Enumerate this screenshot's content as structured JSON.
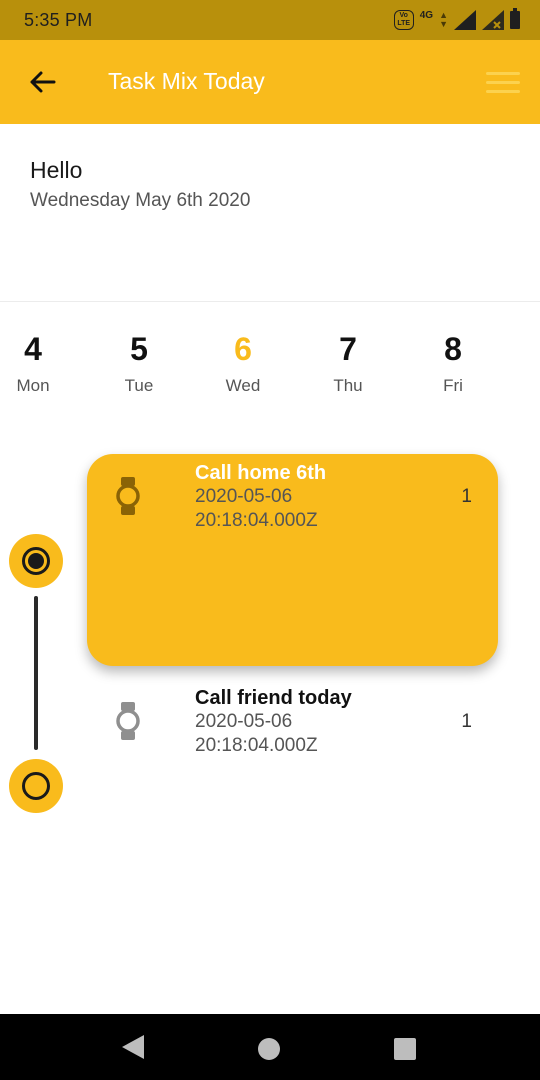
{
  "status_bar": {
    "time": "5:35 PM",
    "volte_label": "VoLTE",
    "network_label": "4G",
    "icons": [
      "volte-icon",
      "signal-icon",
      "signal-icon",
      "battery-icon"
    ]
  },
  "app_bar": {
    "title": "Task Mix Today",
    "back_icon": "arrow-left-icon",
    "menu_icon": "hamburger-menu-icon"
  },
  "greeting": {
    "hello": "Hello",
    "date": "Wednesday May 6th 2020"
  },
  "days": [
    {
      "num": "4",
      "name": "Mon",
      "active": false
    },
    {
      "num": "5",
      "name": "Tue",
      "active": false
    },
    {
      "num": "6",
      "name": "Wed",
      "active": true
    },
    {
      "num": "7",
      "name": "Thu",
      "active": false
    },
    {
      "num": "8",
      "name": "Fri",
      "active": false
    }
  ],
  "tasks": [
    {
      "title": "Call home 6th",
      "date_line1": "2020-05-06",
      "date_line2": "20:18:04.000Z",
      "count": "1",
      "icon": "watch-icon",
      "highlighted": true
    },
    {
      "title": "Call friend today",
      "date_line1": "2020-05-06",
      "date_line2": "20:18:04.000Z",
      "count": "1",
      "icon": "watch-icon",
      "highlighted": false
    }
  ],
  "colors": {
    "accent": "#f9bb1c",
    "status_bar": "#b8900c",
    "text_dark": "#1a1a1a",
    "text_muted": "#555555"
  },
  "nav_bar": {
    "icons": [
      "nav-back-icon",
      "nav-home-icon",
      "nav-recents-icon"
    ]
  }
}
